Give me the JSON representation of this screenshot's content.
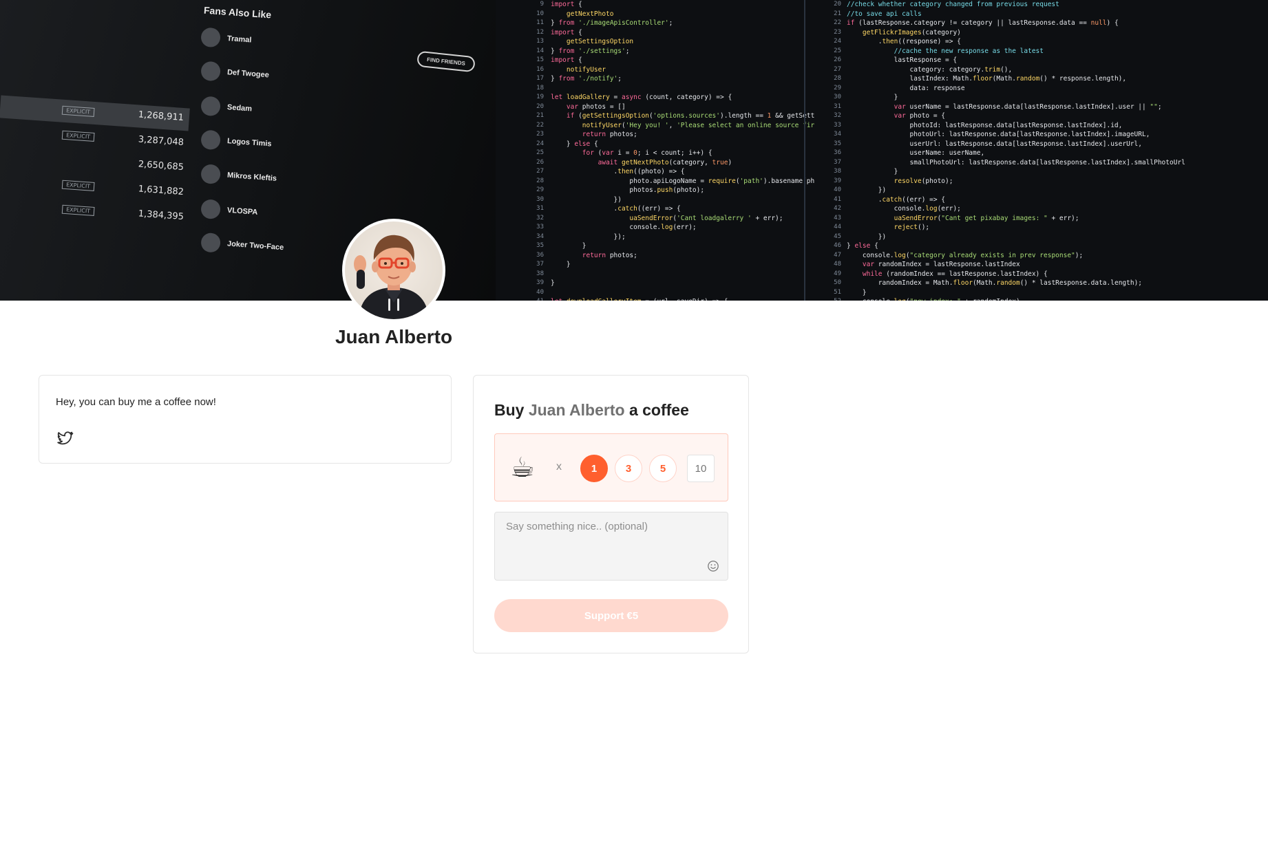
{
  "cover": {
    "fans_title": "Fans Also Like",
    "fans": [
      "Tramal",
      "Def Twogee",
      "Sedam",
      "Logos Timis",
      "Mikros Kleftis",
      "VLOSPA",
      "Joker Two-Face"
    ],
    "rows": [
      {
        "badge": "EXPLICIT",
        "value": "1,268,911"
      },
      {
        "badge": "EXPLICIT",
        "value": "3,287,048"
      },
      {
        "badge": "",
        "value": "2,650,685"
      },
      {
        "badge": "EXPLICIT",
        "value": "1,631,882"
      },
      {
        "badge": "EXPLICIT",
        "value": "1,384,395"
      }
    ],
    "find_friends": "FIND FRIENDS"
  },
  "profile": {
    "name": "Juan Alberto"
  },
  "about": {
    "text": "Hey, you can buy me a coffee now!"
  },
  "buy": {
    "title_prefix": "Buy",
    "creator": "Juan Alberto",
    "title_suffix": "a coffee",
    "cup_icon": "☕",
    "times": "x",
    "options": [
      "1",
      "3",
      "5"
    ],
    "custom_value": "10",
    "message_placeholder": "Say something nice.. (optional)",
    "support_label": "Support €5"
  },
  "colors": {
    "accent": "#ff5f2e",
    "accent_light": "#ffd9cf",
    "qty_bg": "#fff5f2"
  }
}
